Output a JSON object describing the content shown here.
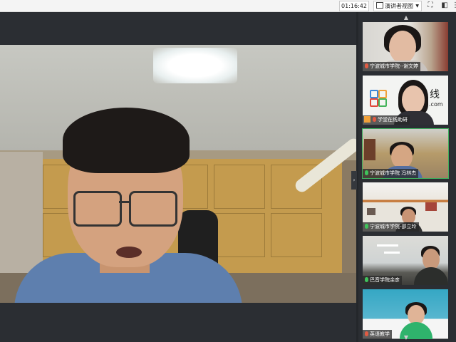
{
  "toolbar": {
    "timer": "01:16:42",
    "view_label": "演讲者视图",
    "icons": [
      "fullscreen-icon",
      "layout-icon",
      "more-icon"
    ]
  },
  "main_video": {
    "speaker": "main presenter"
  },
  "participants": [
    {
      "label": "宁波城市学院--谢文婷",
      "mic": "off"
    },
    {
      "label": "学堂在线助研",
      "mic": "off",
      "brand_text": "线",
      "brand_sub": ".com"
    },
    {
      "label": "宁波城市学院 冯林杰",
      "mic": "on"
    },
    {
      "label": "宁波城市学院-邵立玲",
      "mic": "on"
    },
    {
      "label": "巴音学院余彦",
      "mic": "on"
    },
    {
      "label": "英语教学",
      "mic": "off"
    }
  ]
}
